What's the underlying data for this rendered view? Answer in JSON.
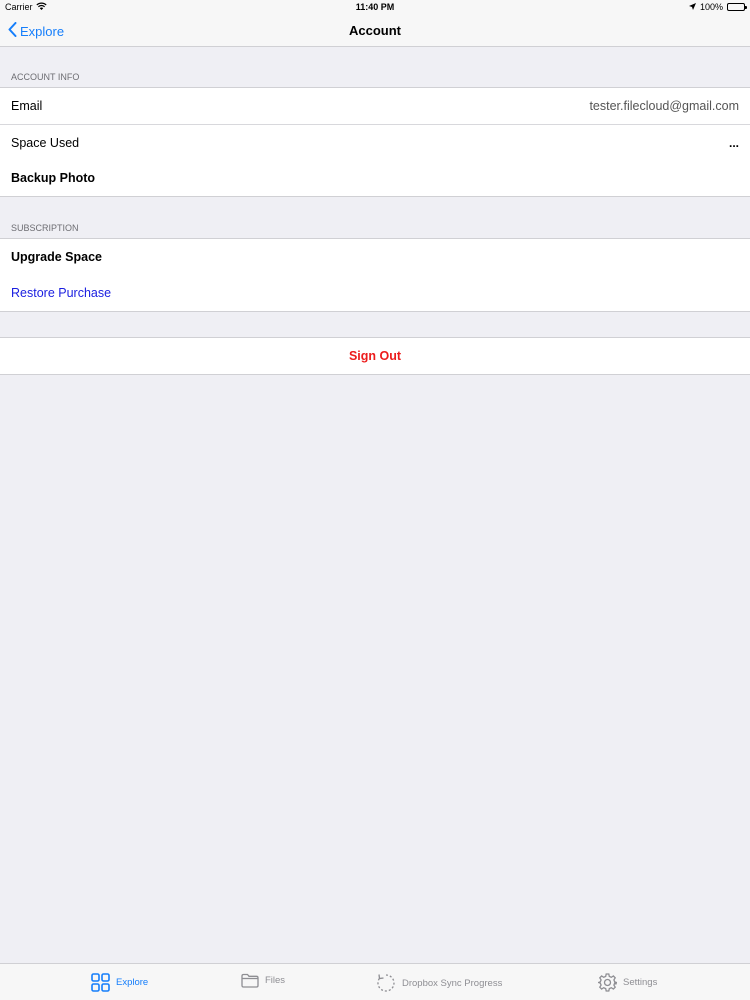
{
  "status": {
    "carrier": "Carrier",
    "time": "11:40 PM",
    "battery": "100%",
    "battery_level": 1.0
  },
  "nav": {
    "back_label": "Explore",
    "title": "Account"
  },
  "account_info": {
    "header": "ACCOUNT INFO",
    "email_label": "Email",
    "email_value": "tester.filecloud@gmail.com",
    "space_used_label": "Space Used",
    "space_used_value": "...",
    "backup_photo_label": "Backup Photo"
  },
  "subscription": {
    "header": "SUBSCRIPTION",
    "upgrade_label": "Upgrade Space",
    "restore_label": "Restore Purchase"
  },
  "sign_out_label": "Sign Out",
  "tabs": [
    {
      "label": "Explore",
      "icon": "grid-icon",
      "active": true
    },
    {
      "label": "Files",
      "icon": "folder-icon",
      "active": false
    },
    {
      "label": "Dropbox Sync Progress",
      "icon": "sync-icon",
      "active": false
    },
    {
      "label": "Settings",
      "icon": "gear-icon",
      "active": false
    }
  ],
  "colors": {
    "accent": "#157efb",
    "destructive": "#ec1c1c",
    "link": "#1a1ee0",
    "background": "#efeff4"
  }
}
